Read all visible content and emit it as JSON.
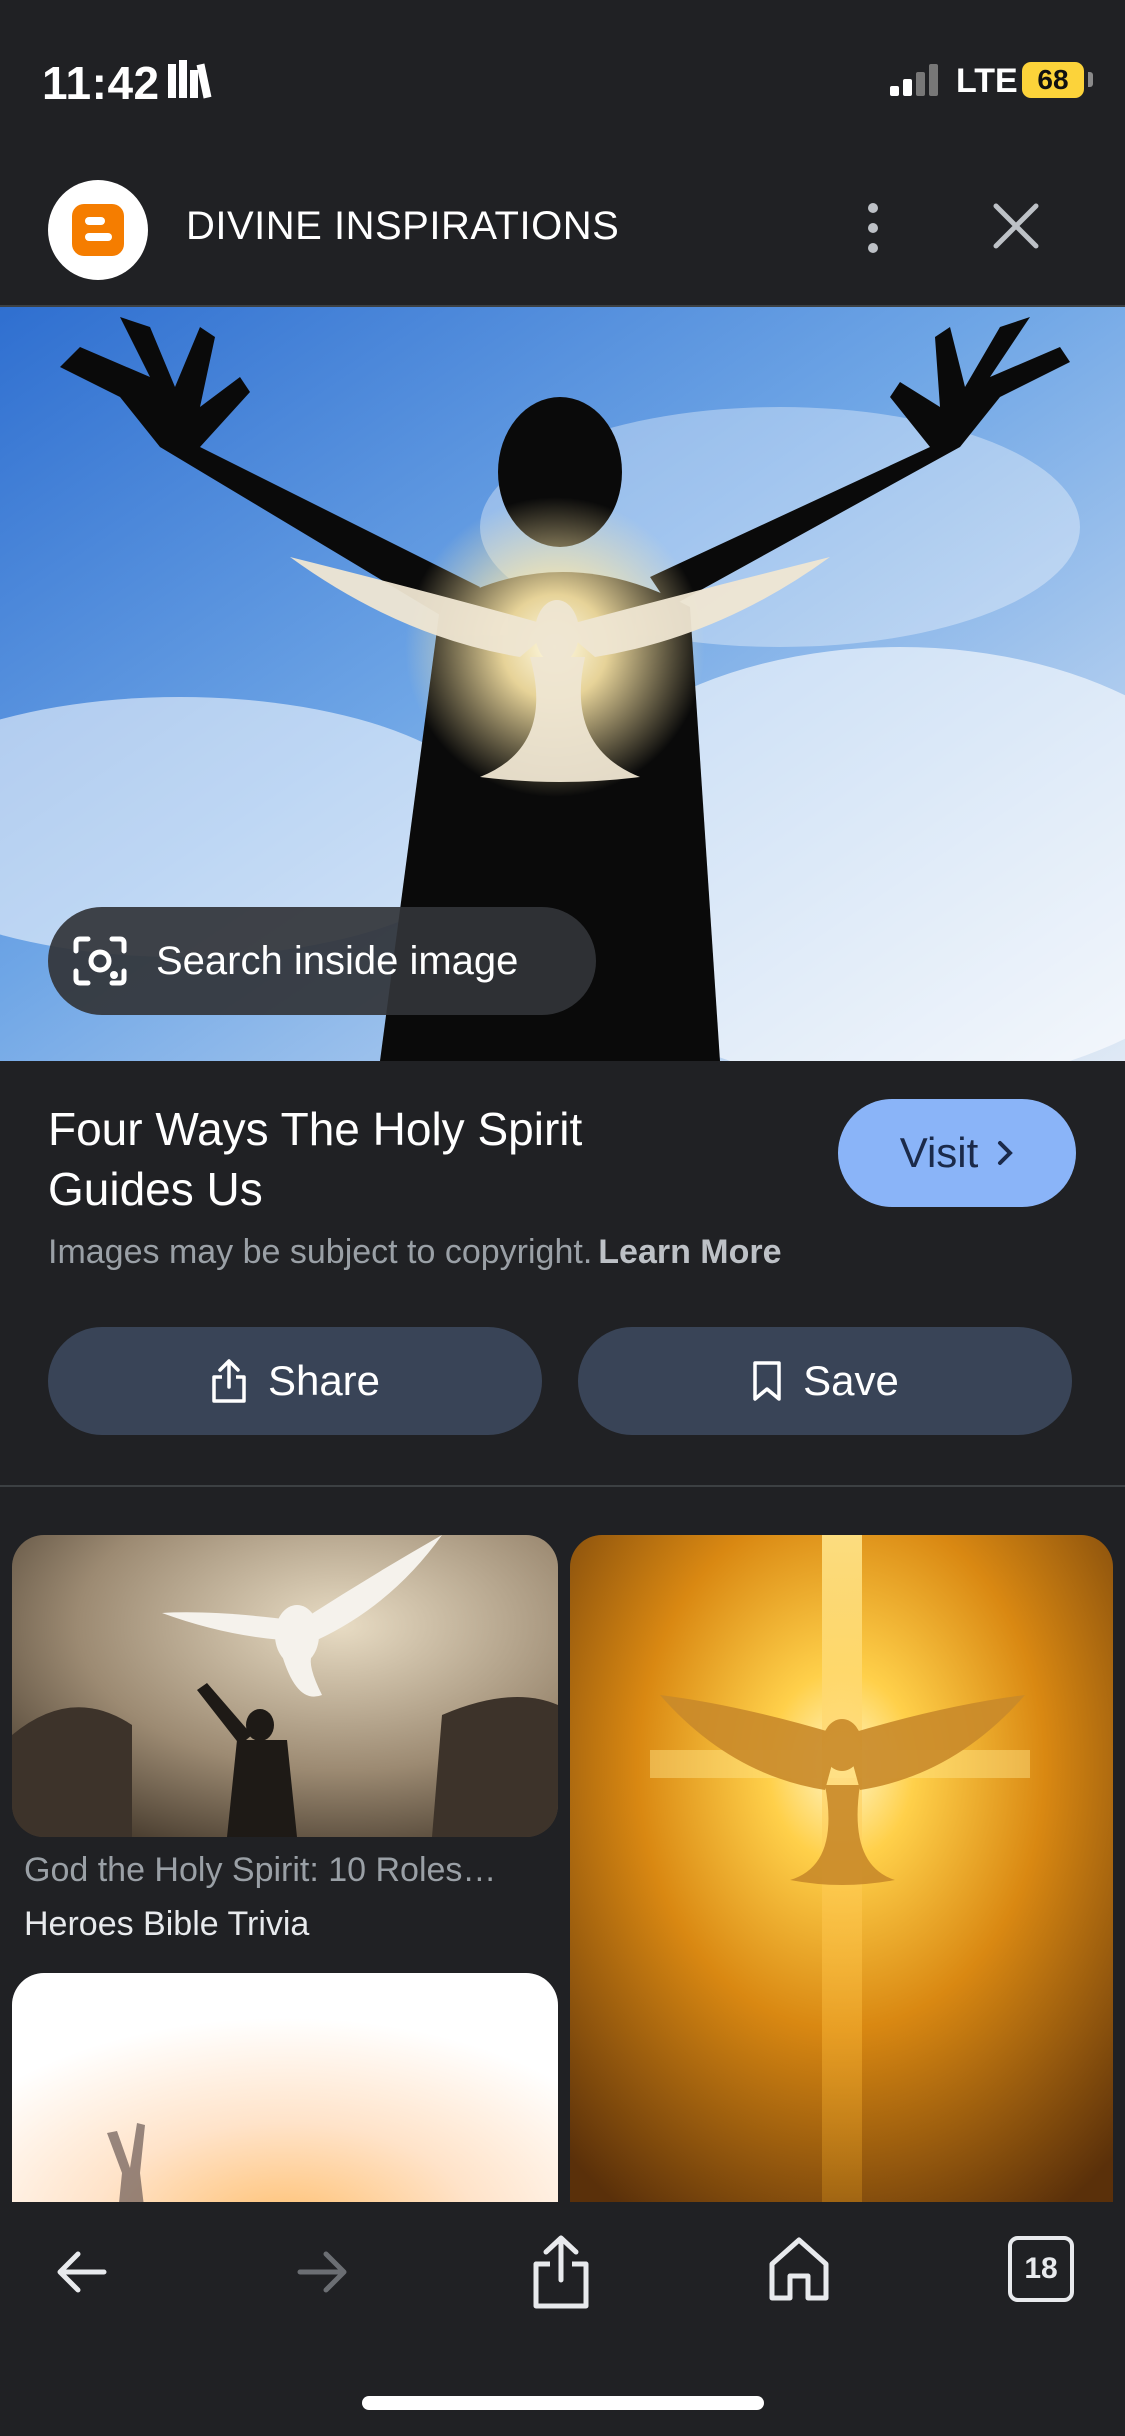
{
  "status_bar": {
    "time": "11:42",
    "network": "LTE",
    "battery": "68"
  },
  "header": {
    "site_name": "DIVINE INSPIRATIONS",
    "logo": "blogger-logo-icon"
  },
  "hero": {
    "lens_label": "Search inside image"
  },
  "result": {
    "title": "Four Ways The Holy Spirit Guides Us",
    "visit_label": "Visit",
    "copyright_text": "Images may be subject to copyright.",
    "learn_more": "Learn More",
    "share_label": "Share",
    "save_label": "Save"
  },
  "related": [
    {
      "caption": "God the Holy Spirit: 10 Roles…",
      "source": "Heroes Bible Trivia"
    }
  ],
  "bottom_bar": {
    "tab_count": "18"
  },
  "colors": {
    "background": "#202124",
    "accent": "#8ab4f8",
    "button_bg": "#394457",
    "blogger": "#f57d00"
  }
}
